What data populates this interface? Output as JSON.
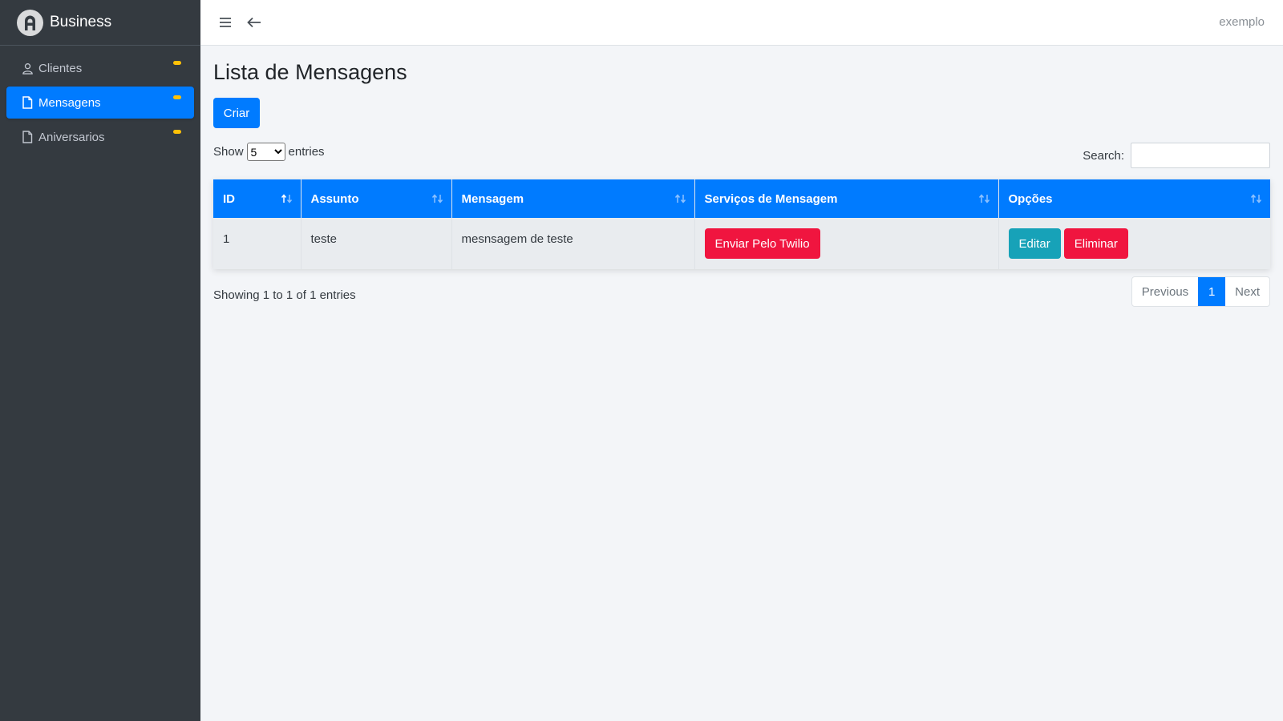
{
  "sidebar": {
    "brand": "Business",
    "items": [
      {
        "label": "Clientes",
        "icon": "user-icon",
        "active": false
      },
      {
        "label": "Mensagens",
        "icon": "file-icon",
        "active": true
      },
      {
        "label": "Aniversarios",
        "icon": "file-icon",
        "active": false
      }
    ]
  },
  "topbar": {
    "user": "exemplo"
  },
  "main": {
    "title": "Lista de Mensagens",
    "create_label": "Criar",
    "length": {
      "prefix": "Show",
      "value": "5",
      "suffix": "entries"
    },
    "search_label": "Search:",
    "table": {
      "headers": [
        "ID",
        "Assunto",
        "Mensagem",
        "Serviços de Mensagem",
        "Opções"
      ],
      "rows": [
        {
          "id": "1",
          "assunto": "teste",
          "mensagem": "mesnsagem de teste",
          "service_button": "Enviar Pelo Twilio",
          "edit_button": "Editar",
          "delete_button": "Eliminar"
        }
      ]
    },
    "info": "Showing 1 to 1 of 1 entries",
    "pagination": {
      "previous": "Previous",
      "current": "1",
      "next": "Next"
    }
  },
  "colors": {
    "primary": "#007bff",
    "danger": "#f0153f",
    "info": "#17a2b8",
    "sidebar": "#343a40",
    "badge": "#ffc107"
  }
}
